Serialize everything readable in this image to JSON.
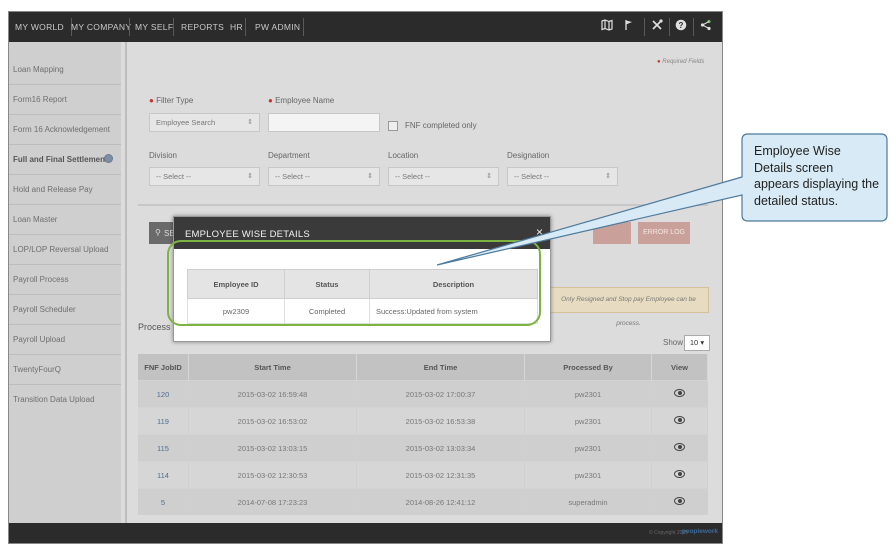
{
  "topnav": {
    "items": [
      "MY WORLD",
      "MY COMPANY",
      "MY SELF",
      "REPORTS",
      "HR",
      "PW ADMIN"
    ],
    "icons": [
      "map-icon",
      "flag-icon",
      "tools-icon",
      "help-icon",
      "share-icon"
    ]
  },
  "sidebar": {
    "items": [
      {
        "label": "Loan Mapping"
      },
      {
        "label": "Form16 Report"
      },
      {
        "label": "Form 16 Acknowledgement"
      },
      {
        "label": "Full and Final Settlement",
        "active": true
      },
      {
        "label": "Hold and Release Pay"
      },
      {
        "label": "Loan Master"
      },
      {
        "label": "LOP/LOP Reversal Upload"
      },
      {
        "label": "Payroll Process"
      },
      {
        "label": "Payroll Scheduler"
      },
      {
        "label": "Payroll Upload"
      },
      {
        "label": "TwentyFourQ"
      },
      {
        "label": "Transition Data Upload"
      }
    ]
  },
  "form": {
    "required_note": "Required Fields",
    "filter_type_label": "Filter Type",
    "filter_type_value": "Employee Search",
    "employee_name_label": "Employee Name",
    "employee_name_value": "",
    "fnf_label": "FNF completed only",
    "division_label": "Division",
    "division_value": "-- Select --",
    "department_label": "Department",
    "department_value": "-- Select --",
    "location_label": "Location",
    "location_value": "-- Select --",
    "designation_label": "Designation",
    "designation_value": "-- Select --",
    "search_button_partial": "SE",
    "error_log_button": "ERROR LOG"
  },
  "notice": "Only Resigned and Stop pay Employee can be process.",
  "process": {
    "title_partial": "Process D",
    "show_label": "Show",
    "show_value": "10",
    "columns": [
      "FNF JobID",
      "Start Time",
      "End Time",
      "Processed By",
      "View"
    ],
    "rows": [
      {
        "id": "120",
        "start": "2015-03-02 16:59:48",
        "end": "2015-03-02 17:00:37",
        "by": "pw2301"
      },
      {
        "id": "119",
        "start": "2015-03-02 16:53:02",
        "end": "2015-03-02 16:53:38",
        "by": "pw2301"
      },
      {
        "id": "115",
        "start": "2015-03-02 13:03:15",
        "end": "2015-03-02 13:03:34",
        "by": "pw2301"
      },
      {
        "id": "114",
        "start": "2015-03-02 12:30:53",
        "end": "2015-03-02 12:31:35",
        "by": "pw2301"
      },
      {
        "id": "5",
        "start": "2014-07-08 17:23:23",
        "end": "2014-08-26 12:41:12",
        "by": "superadmin"
      }
    ]
  },
  "modal": {
    "title": "EMPLOYEE WISE DETAILS",
    "close": "×",
    "columns": [
      "Employee ID",
      "Status",
      "Description"
    ],
    "row": {
      "employee_id": "pw2309",
      "status": "Completed",
      "description": "Success:Updated from system"
    }
  },
  "footer": {
    "copyright": "© Copyright 2015",
    "brand": "peoplework"
  },
  "callout": {
    "text": "Employee Wise Details screen appears displaying the detailed status."
  },
  "colors": {
    "nav_bg": "#2b2b2b",
    "highlight_green": "#7cb342",
    "callout_fill": "#d7eaf5",
    "callout_border": "#4e7a9c"
  }
}
